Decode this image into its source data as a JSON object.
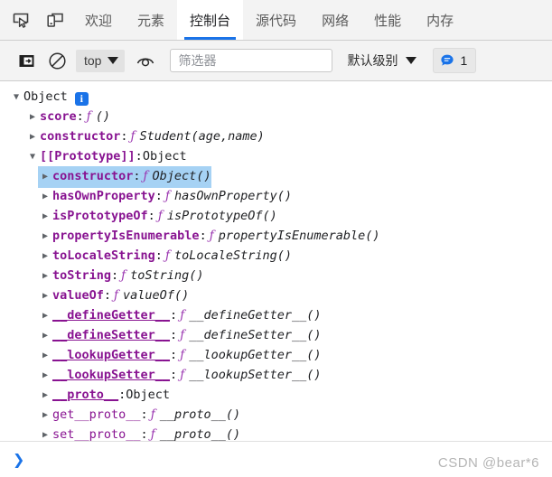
{
  "tabbar": {
    "icons": [
      {
        "name": "inspect-element-icon"
      },
      {
        "name": "device-toolbar-icon"
      }
    ],
    "tabs": [
      {
        "label": "欢迎",
        "active": false
      },
      {
        "label": "元素",
        "active": false
      },
      {
        "label": "控制台",
        "active": true
      },
      {
        "label": "源代码",
        "active": false
      },
      {
        "label": "网络",
        "active": false
      },
      {
        "label": "性能",
        "active": false
      },
      {
        "label": "内存",
        "active": false
      }
    ],
    "active_tab_underline_color": "#1a73e8"
  },
  "toolbar": {
    "sidebar_toggle_icon": "console-sidebar-icon",
    "clear_console_icon": "clear-console-icon",
    "context_selector": {
      "value": "top",
      "caret": "▼"
    },
    "live_expression_icon": "eye-icon",
    "filter": {
      "value": "",
      "placeholder": "筛选器"
    },
    "level_selector": {
      "value": "默认级别",
      "caret": "▼"
    },
    "message_badge": {
      "icon": "message-bubble-icon",
      "count": "1",
      "color": "#1a73e8"
    }
  },
  "console": {
    "rows": [
      {
        "indent": 0,
        "arrow": "▼",
        "type": "root",
        "label": "Object",
        "badge": "i"
      },
      {
        "indent": 1,
        "arrow": "▶",
        "type": "fn",
        "key": "score",
        "colon": ":",
        "fn": "ƒ",
        "value": "()"
      },
      {
        "indent": 1,
        "arrow": "▶",
        "type": "fn",
        "key": "constructor",
        "colon": ":",
        "fn": "ƒ",
        "value": "Student(age,name)"
      },
      {
        "indent": 1,
        "arrow": "▼",
        "type": "proto-header",
        "key": "[[Prototype]]",
        "colon": ":",
        "value": "Object"
      },
      {
        "indent": 2,
        "arrow": "▶",
        "type": "fn",
        "key": "constructor",
        "colon": ":",
        "fn": "ƒ",
        "value": "Object()",
        "selected": true
      },
      {
        "indent": 2,
        "arrow": "▶",
        "type": "fn",
        "key": "hasOwnProperty",
        "colon": ":",
        "fn": "ƒ",
        "value": "hasOwnProperty()"
      },
      {
        "indent": 2,
        "arrow": "▶",
        "type": "fn",
        "key": "isPrototypeOf",
        "colon": ":",
        "fn": "ƒ",
        "value": "isPrototypeOf()"
      },
      {
        "indent": 2,
        "arrow": "▶",
        "type": "fn",
        "key": "propertyIsEnumerable",
        "colon": ":",
        "fn": "ƒ",
        "value": "propertyIsEnumerable()"
      },
      {
        "indent": 2,
        "arrow": "▶",
        "type": "fn",
        "key": "toLocaleString",
        "colon": ":",
        "fn": "ƒ",
        "value": "toLocaleString()"
      },
      {
        "indent": 2,
        "arrow": "▶",
        "type": "fn",
        "key": "toString",
        "colon": ":",
        "fn": "ƒ",
        "value": "toString()"
      },
      {
        "indent": 2,
        "arrow": "▶",
        "type": "fn",
        "key": "valueOf",
        "colon": ":",
        "fn": "ƒ",
        "value": "valueOf()"
      },
      {
        "indent": 2,
        "arrow": "▶",
        "type": "fn-underline",
        "key": "__defineGetter__",
        "colon": ":",
        "fn": "ƒ",
        "value": "__defineGetter__()"
      },
      {
        "indent": 2,
        "arrow": "▶",
        "type": "fn-underline",
        "key": "__defineSetter__",
        "colon": ":",
        "fn": "ƒ",
        "value": "__defineSetter__()"
      },
      {
        "indent": 2,
        "arrow": "▶",
        "type": "fn-underline",
        "key": "__lookupGetter__",
        "colon": ":",
        "fn": "ƒ",
        "value": "__lookupGetter__()"
      },
      {
        "indent": 2,
        "arrow": "▶",
        "type": "fn-underline",
        "key": "__lookupSetter__",
        "colon": ":",
        "fn": "ƒ",
        "value": "__lookupSetter__()"
      },
      {
        "indent": 2,
        "arrow": "▶",
        "type": "obj-underline",
        "key": "__proto__",
        "colon": ":",
        "value": "Object"
      },
      {
        "indent": 2,
        "arrow": "▶",
        "type": "accessor",
        "accessor": "get",
        "key": "__proto__",
        "colon": ":",
        "fn": "ƒ",
        "value": "__proto__()"
      },
      {
        "indent": 2,
        "arrow": "▶",
        "type": "accessor",
        "accessor": "set",
        "key": "__proto__",
        "colon": ":",
        "fn": "ƒ",
        "value": "__proto__()"
      }
    ]
  },
  "prompt": {
    "caret": "❯",
    "value": ""
  },
  "watermark": "CSDN @bear*6"
}
